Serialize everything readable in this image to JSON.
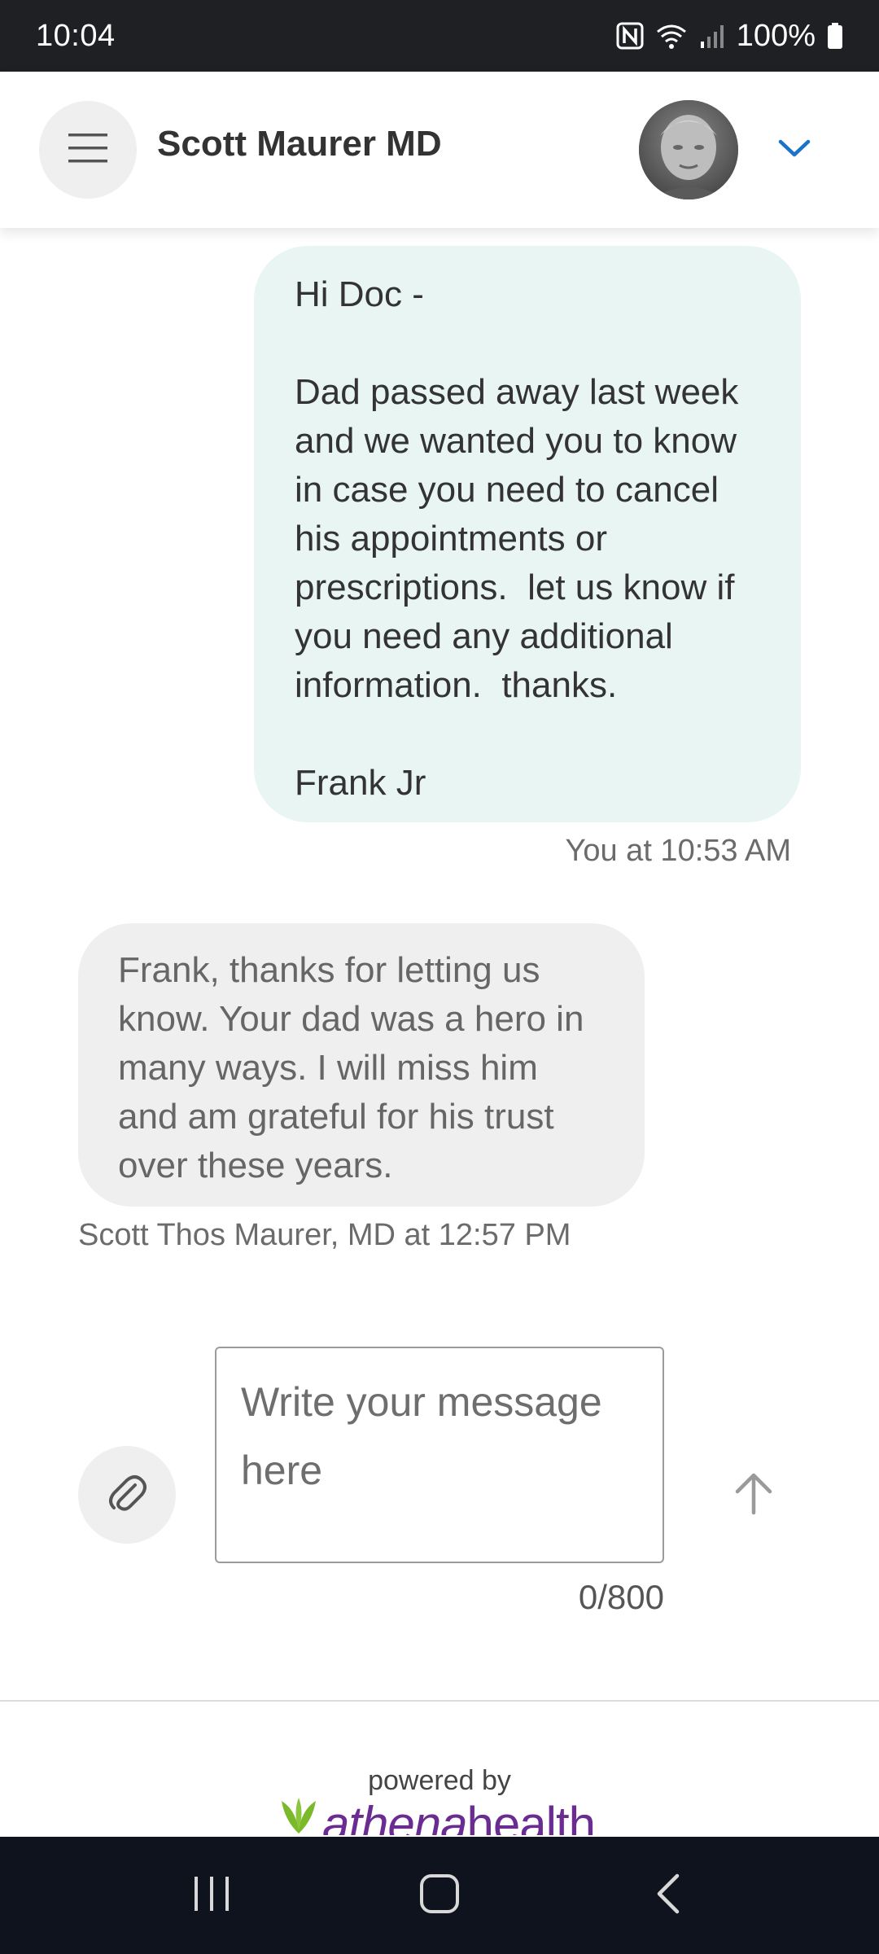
{
  "status_bar": {
    "time": "10:04",
    "battery": "100%",
    "icons": [
      "nfc-icon",
      "wifi-icon",
      "signal-icon",
      "battery-icon"
    ]
  },
  "header": {
    "title": "Scott Maurer MD",
    "menu_icon": "hamburger-menu-icon",
    "dropdown_icon": "chevron-down-icon"
  },
  "conversation": {
    "messages": [
      {
        "direction": "outgoing",
        "body": "Hi Doc -\n\nDad passed away last week and we wanted you to know in case you need to cancel his appointments or prescriptions.  let us know if you need any additional information.  thanks.\n\nFrank Jr",
        "meta": "You at 10:53 AM"
      },
      {
        "direction": "incoming",
        "body": "Frank, thanks for letting us know. Your dad was a hero in many ways. I will miss him and am grateful for his trust over these years.",
        "meta": "Scott Thos Maurer, MD at 12:57 PM"
      }
    ]
  },
  "composer": {
    "placeholder": "Write your message here",
    "value": "",
    "char_count": "0/800",
    "attach_icon": "paperclip-icon",
    "send_icon": "arrow-up-icon"
  },
  "footer": {
    "powered_by": "powered by",
    "brand_main": "athena",
    "brand_secondary": "health"
  },
  "colors": {
    "accent": "#1a73c8",
    "outgoing_bubble": "#e8f5f3",
    "incoming_bubble": "#efefef",
    "brand_purple": "#6a2c91",
    "brand_green": "#7ab929"
  }
}
